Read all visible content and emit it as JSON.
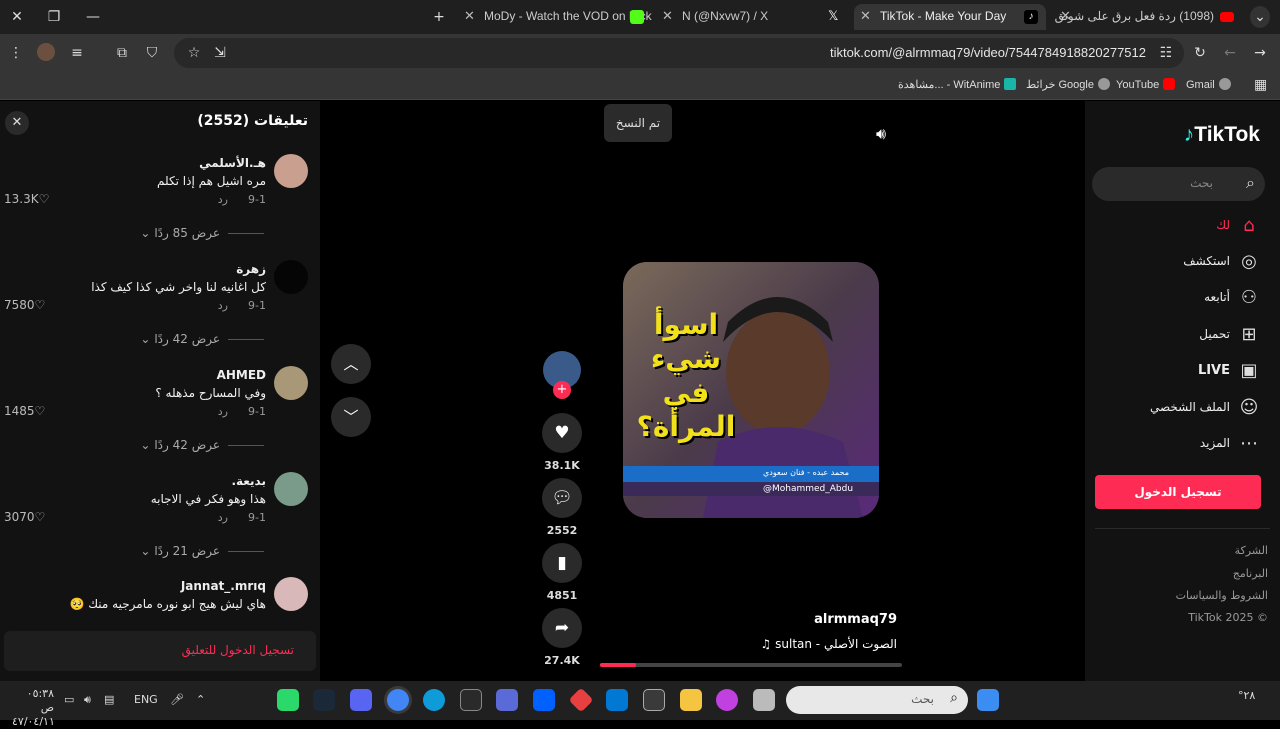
{
  "browser": {
    "tabs": [
      {
        "title": "MoDy - Watch the VOD on Kick",
        "active": false
      },
      {
        "title": "N (@Nxvw7) / X",
        "active": false
      },
      {
        "title": "TikTok - Make Your Day",
        "active": true
      },
      {
        "title": "(1098) ردة فعل برق على شونق (",
        "active": false
      }
    ],
    "url": "tiktok.com/@alrmmaq79/video/7544784918820277512",
    "bookmarks": [
      "Gmail",
      "YouTube",
      "خرائط Google",
      "مشاهدة... - WitAnime"
    ]
  },
  "comments": {
    "title": "تعليقات (2552)",
    "items": [
      {
        "user": "هـ.الأسلمي",
        "text": "مره اشيل هم إذا تكلم",
        "date": "9-1",
        "reply": "رد",
        "likes": "13.3K",
        "more": "عرض 85 ردًا"
      },
      {
        "user": "زهرة",
        "text": "كل اغانيه لنا واخر شي كذا كيف كذا",
        "date": "9-1",
        "reply": "رد",
        "likes": "7580",
        "more": "عرض 42 ردًا"
      },
      {
        "user": "AHMED",
        "text": "وفي المسارح مذهله ؟",
        "date": "9-1",
        "reply": "رد",
        "likes": "1485",
        "more": "عرض 42 ردًا"
      },
      {
        "user": "بديعة.",
        "text": "هذا وهو فكر في الاجابه",
        "date": "9-1",
        "reply": "رد",
        "likes": "3070",
        "more": "عرض 21 ردًا"
      },
      {
        "user": "Jannat_.mrıq",
        "text": "هاي ليش هيج ابو نوره مامرجيه منك 🥺",
        "date": "",
        "reply": "",
        "likes": "",
        "more": ""
      }
    ],
    "login_prompt": "تسجيل الدخول للتعليق"
  },
  "player": {
    "toast": "تم النسخ",
    "caption_overlay": "اسوأ شيء في المرأة؟",
    "video_banner": "محمد عبده - فنان سعودي",
    "video_handle": "@Mohammed_Abdu",
    "likes": "38.1K",
    "comments": "2552",
    "saves": "4851",
    "shares": "27.4K",
    "author": "alrmmaq79",
    "sound": "الصوت الأصلي - sultan",
    "progress": 0.12
  },
  "sidenav": {
    "logo": "TikTok",
    "search_placeholder": "بحث",
    "items": [
      {
        "label": "لك",
        "icon": "home-icon"
      },
      {
        "label": "استكشف",
        "icon": "compass-icon"
      },
      {
        "label": "أتابعه",
        "icon": "user-follow-icon"
      },
      {
        "label": "تحميل",
        "icon": "upload-icon"
      },
      {
        "label": "LIVE",
        "icon": "live-icon"
      },
      {
        "label": "الملف الشخصي",
        "icon": "profile-icon"
      },
      {
        "label": "المزيد",
        "icon": "more-icon"
      }
    ],
    "signin": "تسجيل الدخول",
    "footer": [
      "الشركة",
      "البرنامج",
      "الشروط والسياسات",
      "© TikTok 2025"
    ]
  },
  "taskbar": {
    "search_placeholder": "بحث",
    "lang": "ENG",
    "time": "٠٥:٣٨ ص",
    "date": "٤٧/٠٤/١١",
    "weather": "°٢٨"
  },
  "colors": {
    "accent": "#fe2c55",
    "panel": "#121212",
    "chrome": "#353535"
  }
}
